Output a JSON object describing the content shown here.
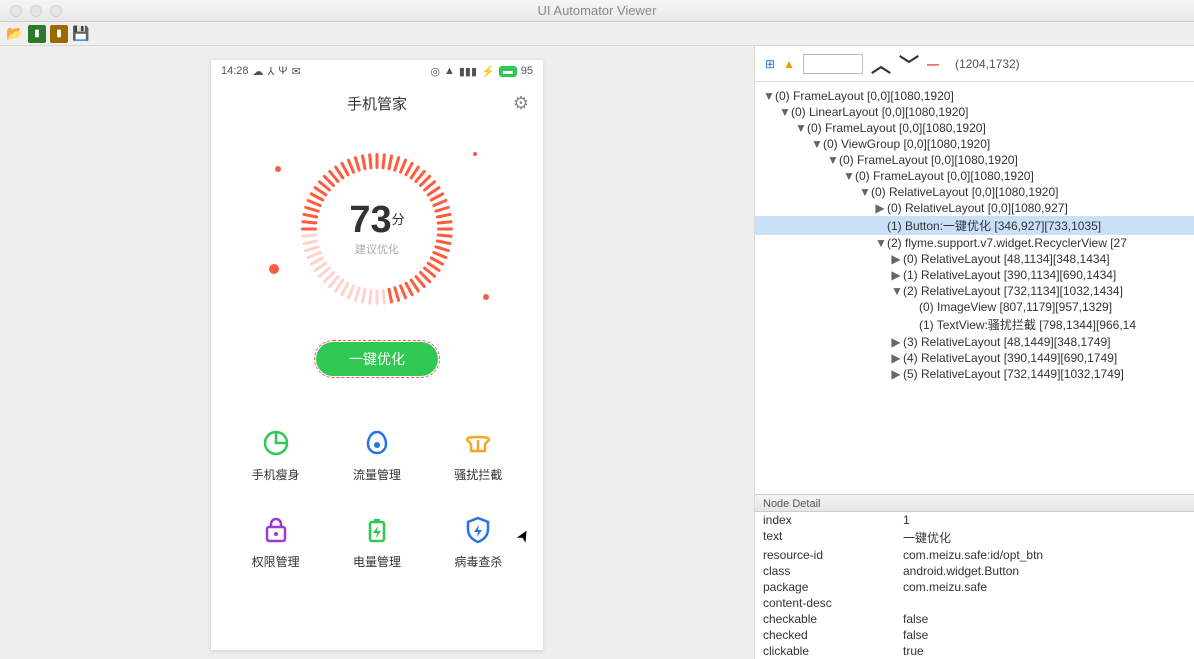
{
  "window_title": "UI Automator Viewer",
  "statusbar": {
    "time": "14:28",
    "battery": "95"
  },
  "app": {
    "title": "手机管家",
    "score": "73",
    "score_unit": "分",
    "score_sub": "建议优化",
    "optimize_btn": "一键优化"
  },
  "grid": [
    {
      "name": "phone-slim",
      "label": "手机瘦身"
    },
    {
      "name": "data-mgmt",
      "label": "流量管理"
    },
    {
      "name": "block",
      "label": "骚扰拦截"
    },
    {
      "name": "perm",
      "label": "权限管理"
    },
    {
      "name": "battery",
      "label": "电量管理"
    },
    {
      "name": "virus",
      "label": "病毒查杀"
    }
  ],
  "coords": "(1204,1732)",
  "tree": [
    {
      "d": 0,
      "t": "▼",
      "s": false,
      "txt": "(0) FrameLayout [0,0][1080,1920]"
    },
    {
      "d": 1,
      "t": "▼",
      "s": false,
      "txt": "(0) LinearLayout [0,0][1080,1920]"
    },
    {
      "d": 2,
      "t": "▼",
      "s": false,
      "txt": "(0) FrameLayout [0,0][1080,1920]"
    },
    {
      "d": 3,
      "t": "▼",
      "s": false,
      "txt": "(0) ViewGroup [0,0][1080,1920]"
    },
    {
      "d": 4,
      "t": "▼",
      "s": false,
      "txt": "(0) FrameLayout [0,0][1080,1920]"
    },
    {
      "d": 5,
      "t": "▼",
      "s": false,
      "txt": "(0) FrameLayout [0,0][1080,1920]"
    },
    {
      "d": 6,
      "t": "▼",
      "s": false,
      "txt": "(0) RelativeLayout [0,0][1080,1920]"
    },
    {
      "d": 7,
      "t": "▶",
      "s": false,
      "txt": "(0) RelativeLayout [0,0][1080,927]"
    },
    {
      "d": 7,
      "t": "",
      "s": true,
      "txt": "(1) Button:一键优化 [346,927][733,1035]"
    },
    {
      "d": 7,
      "t": "▼",
      "s": false,
      "txt": "(2) flyme.support.v7.widget.RecyclerView [27"
    },
    {
      "d": 8,
      "t": "▶",
      "s": false,
      "txt": "(0) RelativeLayout [48,1134][348,1434]"
    },
    {
      "d": 8,
      "t": "▶",
      "s": false,
      "txt": "(1) RelativeLayout [390,1134][690,1434]"
    },
    {
      "d": 8,
      "t": "▼",
      "s": false,
      "txt": "(2) RelativeLayout [732,1134][1032,1434]"
    },
    {
      "d": 9,
      "t": "",
      "s": false,
      "txt": "(0) ImageView [807,1179][957,1329]"
    },
    {
      "d": 9,
      "t": "",
      "s": false,
      "txt": "(1) TextView:骚扰拦截 [798,1344][966,14"
    },
    {
      "d": 8,
      "t": "▶",
      "s": false,
      "txt": "(3) RelativeLayout [48,1449][348,1749]"
    },
    {
      "d": 8,
      "t": "▶",
      "s": false,
      "txt": "(4) RelativeLayout [390,1449][690,1749]"
    },
    {
      "d": 8,
      "t": "▶",
      "s": false,
      "txt": "(5) RelativeLayout [732,1449][1032,1749]"
    }
  ],
  "detail_title": "Node Detail",
  "detail": [
    {
      "k": "index",
      "v": "1"
    },
    {
      "k": "text",
      "v": "一键优化"
    },
    {
      "k": "resource-id",
      "v": "com.meizu.safe:id/opt_btn"
    },
    {
      "k": "class",
      "v": "android.widget.Button"
    },
    {
      "k": "package",
      "v": "com.meizu.safe"
    },
    {
      "k": "content-desc",
      "v": ""
    },
    {
      "k": "checkable",
      "v": "false"
    },
    {
      "k": "checked",
      "v": "false"
    },
    {
      "k": "clickable",
      "v": "true"
    }
  ]
}
